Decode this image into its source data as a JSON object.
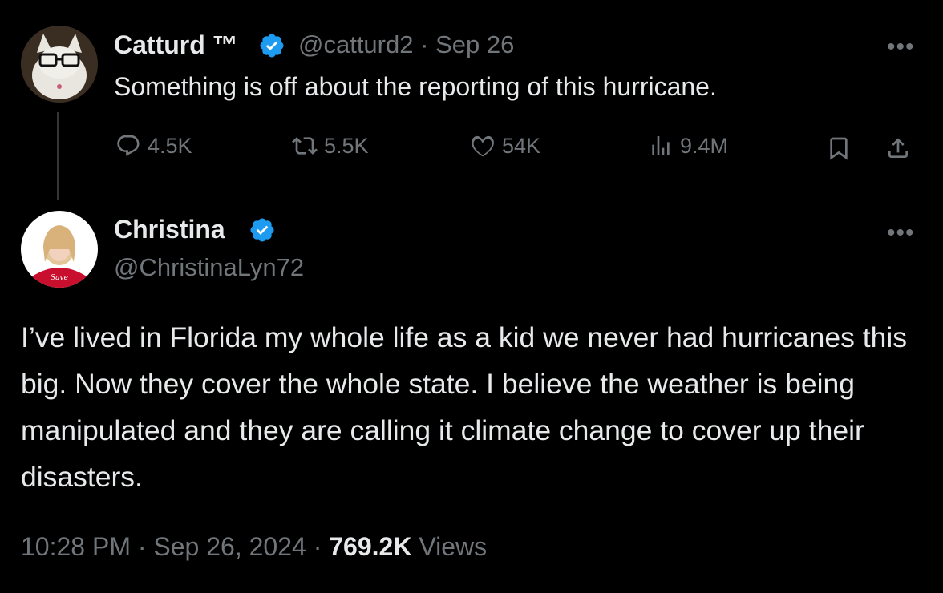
{
  "parent_tweet": {
    "display_name": "Catturd ™",
    "handle": "@catturd2",
    "separator": "·",
    "date": "Sep 26",
    "text": "Something is off about the reporting of this hurricane.",
    "actions": {
      "replies": "4.5K",
      "reposts": "5.5K",
      "likes": "54K",
      "views": "9.4M"
    },
    "more_label": "•••"
  },
  "main_tweet": {
    "display_name": "Christina",
    "handle": "@ChristinaLyn72",
    "text": "I’ve lived in Florida my whole life as a kid we never had hurricanes this big. Now they cover the whole state. I believe the weather is being manipulated and they are calling it climate change to cover up their disasters.",
    "time": "10:28 PM",
    "separator": "·",
    "date": "Sep 26, 2024",
    "views_count": "769.2K",
    "views_label": "Views",
    "more_label": "•••"
  },
  "colors": {
    "background": "#000000",
    "text_primary": "#e7e9ea",
    "text_secondary": "#71767b",
    "verified_blue": "#1d9bf0",
    "thread_line": "#333639"
  },
  "icons": [
    "reply-icon",
    "repost-icon",
    "like-icon",
    "views-icon",
    "bookmark-icon",
    "share-icon",
    "verified-badge-icon",
    "more-icon"
  ]
}
